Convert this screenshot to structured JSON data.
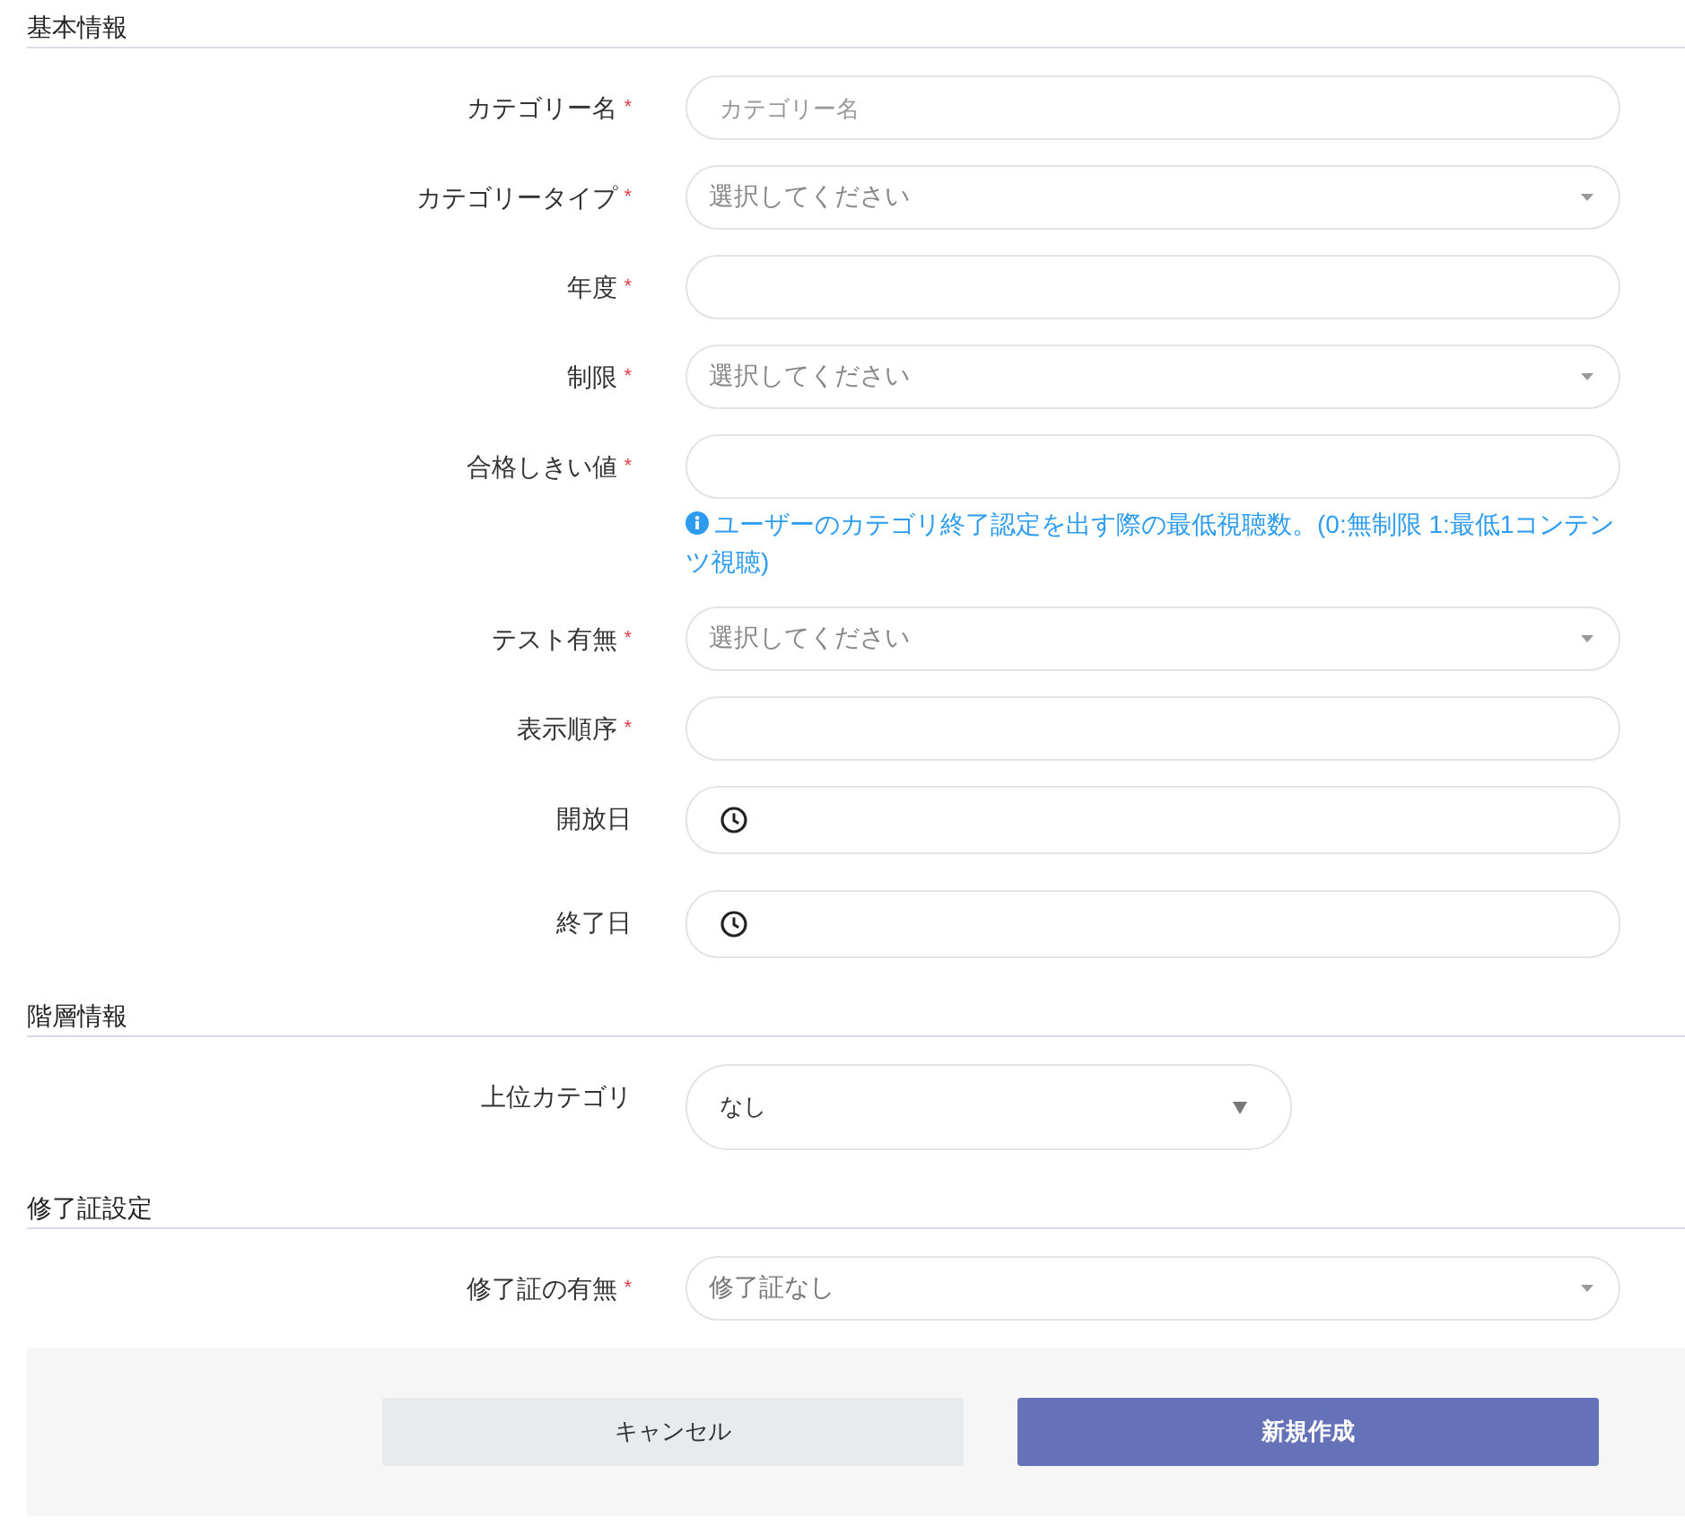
{
  "sections": [
    {
      "title": "基本情報",
      "fields": [
        {
          "label": "カテゴリー名",
          "mark": "*",
          "kind": "text",
          "placeholder": "カテゴリー名"
        },
        {
          "label": "カテゴリータイプ",
          "mark": "*",
          "kind": "select",
          "placeholder": "選択してください"
        },
        {
          "label": "年度",
          "mark": "*",
          "kind": "text"
        },
        {
          "label": "制限",
          "mark": "*",
          "kind": "select",
          "placeholder": "選択してください"
        },
        {
          "label": "合格しきい値",
          "mark": "*",
          "kind": "text",
          "hint": "ユーザーのカテゴリ終了認定を出す際の最低視聴数。(0:無制限 1:最低1コンテンツ視聴)"
        },
        {
          "label": "テスト有無",
          "mark": "*",
          "kind": "select",
          "placeholder": "選択してください"
        },
        {
          "label": "表示順序",
          "mark": "*",
          "kind": "text"
        },
        {
          "label": "開放日",
          "kind": "date"
        },
        {
          "label": "終了日",
          "kind": "date"
        }
      ]
    },
    {
      "title": "階層情報",
      "fields": [
        {
          "label": "上位カテゴリ",
          "kind": "dropdown",
          "value": "なし"
        }
      ]
    },
    {
      "title": "修了証設定",
      "fields": [
        {
          "label": "修了証の有無",
          "mark": "*",
          "kind": "select",
          "value": "修了証なし"
        }
      ]
    }
  ],
  "buttons": [
    {
      "label": "キャンセル",
      "kind": "secondary"
    },
    {
      "label": "新規作成",
      "kind": "primary"
    }
  ]
}
